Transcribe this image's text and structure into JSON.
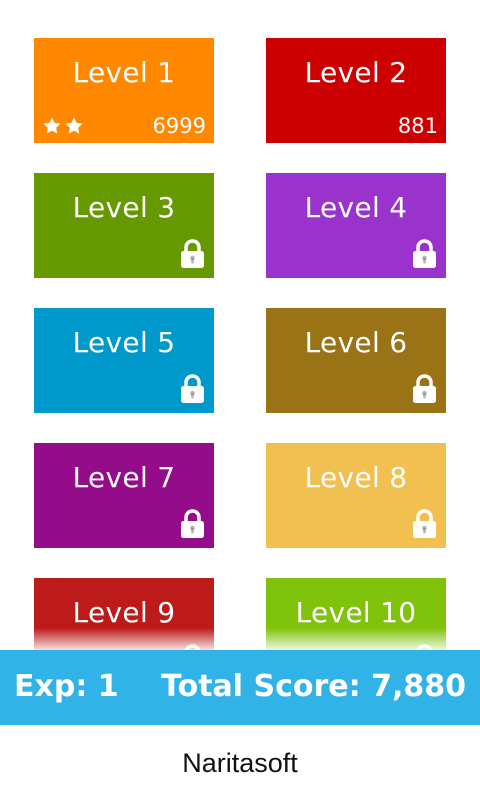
{
  "levels": [
    {
      "label": "Level 1",
      "color": "#ff8800",
      "stars": 2,
      "score": "6999",
      "locked": false
    },
    {
      "label": "Level 2",
      "color": "#cc0000",
      "stars": 0,
      "score": "881",
      "locked": false
    },
    {
      "label": "Level 3",
      "color": "#669900",
      "stars": 0,
      "score": "",
      "locked": true
    },
    {
      "label": "Level 4",
      "color": "#9933cc",
      "stars": 0,
      "score": "",
      "locked": true
    },
    {
      "label": "Level 5",
      "color": "#0099cc",
      "stars": 0,
      "score": "",
      "locked": true
    },
    {
      "label": "Level 6",
      "color": "#997316",
      "stars": 0,
      "score": "",
      "locked": true
    },
    {
      "label": "Level 7",
      "color": "#950c8a",
      "stars": 0,
      "score": "",
      "locked": true
    },
    {
      "label": "Level 8",
      "color": "#f2c050",
      "stars": 0,
      "score": "",
      "locked": true
    },
    {
      "label": "Level 9",
      "color": "#bd1a1a",
      "stars": 0,
      "score": "",
      "locked": true
    },
    {
      "label": "Level 10",
      "color": "#7fc30c",
      "stars": 0,
      "score": "",
      "locked": true
    }
  ],
  "status": {
    "exp": "Exp: 1",
    "total_score": "Total Score: 7,880"
  },
  "footer": {
    "brand": "Naritasoft"
  },
  "icons": {
    "star": "star-icon",
    "lock": "lock-icon"
  }
}
